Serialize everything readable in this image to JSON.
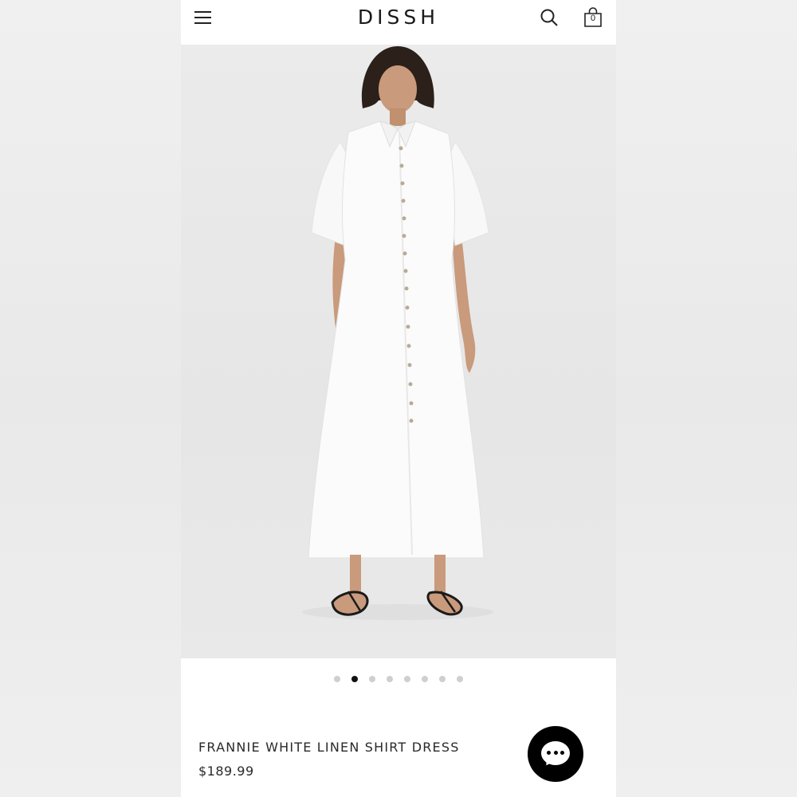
{
  "header": {
    "brand": "DISSH",
    "menu_icon": "hamburger-menu-icon",
    "search_icon": "search-icon",
    "cart_icon": "shopping-bag-icon",
    "cart_count": "0"
  },
  "gallery": {
    "slide_count": 8,
    "active_index": 1,
    "image_description_icon": "product-photo"
  },
  "product": {
    "title": "FRANNIE WHITE LINEN SHIRT DRESS",
    "price": "$189.99"
  },
  "chat": {
    "icon": "chat-bubble-icon"
  },
  "colors": {
    "text": "#2a2a2a",
    "active_dot": "#111111",
    "inactive_dot": "#cfcfcf",
    "chat_button": "#000000"
  }
}
